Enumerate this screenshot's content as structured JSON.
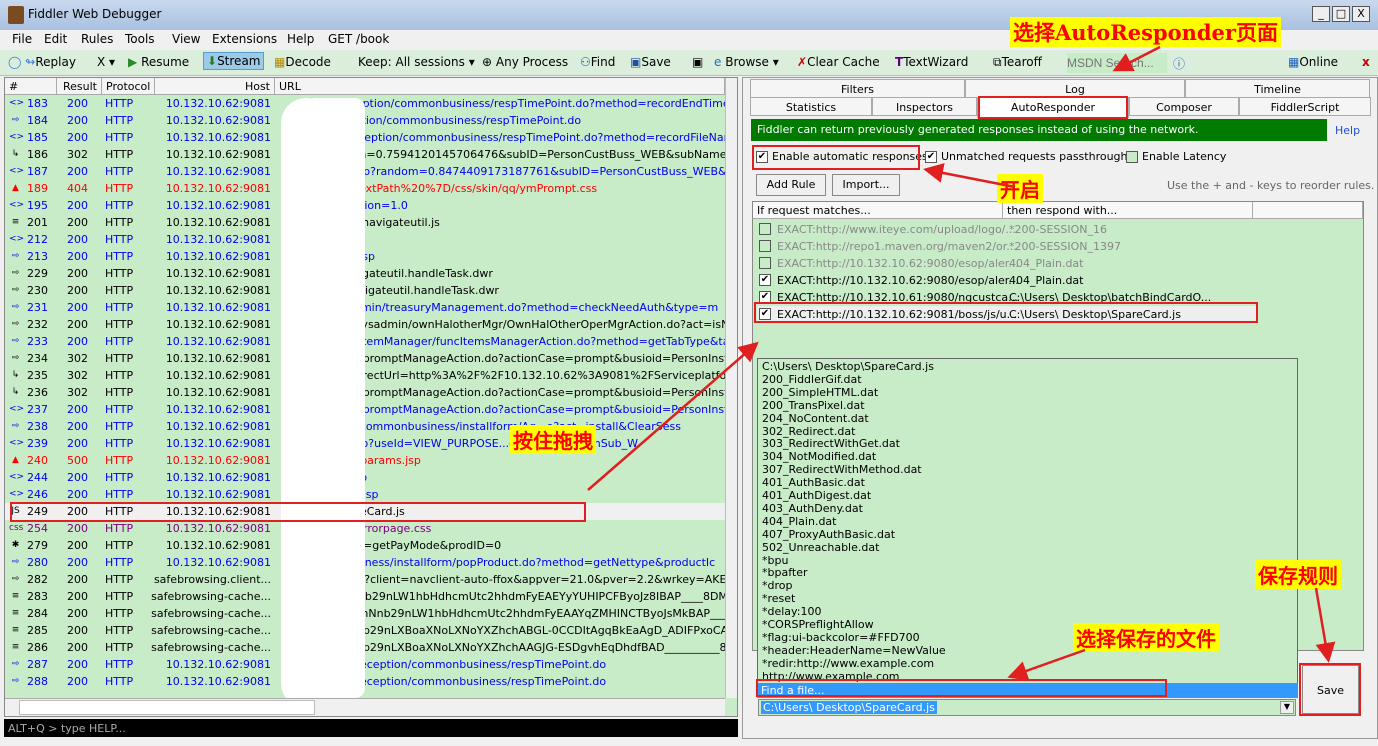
{
  "window": {
    "title": "Fiddler Web Debugger",
    "min": "_",
    "max": "□",
    "close": "X"
  },
  "menu": [
    "File",
    "Edit",
    "Rules",
    "Tools",
    "View",
    "Extensions",
    "Help",
    "GET /book"
  ],
  "toolbar": {
    "replay": "Replay",
    "remove": "X ▾",
    "resume": "Resume",
    "stream": "Stream",
    "decode": "Decode",
    "keep": "Keep: All sessions ▾",
    "process": "Any Process",
    "find": "Find",
    "save": "Save",
    "browse": "Browse ▾",
    "clear_cache": "Clear Cache",
    "textwizard": "TextWizard",
    "tearoff": "Tearoff",
    "msdn_placeholder": "MSDN Search...",
    "online": "Online"
  },
  "sessions": {
    "columns": [
      "#",
      "Result",
      "Protocol",
      "Host",
      "URL"
    ],
    "rows": [
      {
        "id": "183",
        "result": "200",
        "protocol": "HTTP",
        "host": "10.132.10.62:9081",
        "url": "/reception/commonbusiness/respTimePoint.do?method=recordEndTime",
        "color": "blue",
        "icon": "<>"
      },
      {
        "id": "184",
        "result": "200",
        "protocol": "HTTP",
        "host": "10.132.10.62:9081",
        "url": "eception/commonbusiness/respTimePoint.do",
        "color": "blue",
        "icon": "⇨"
      },
      {
        "id": "185",
        "result": "200",
        "protocol": "HTTP",
        "host": "10.132.10.62:9081",
        "url": "D/reception/commonbusiness/respTimePoint.do?method=recordFileNam",
        "color": "blue",
        "icon": "<>"
      },
      {
        "id": "186",
        "result": "302",
        "protocol": "HTTP",
        "host": "10.132.10.62:9081",
        "url": "ndom=0.7594120145706476&subID=PersonCustBuss_WEB&subName=%E",
        "color": "black",
        "icon": "↳"
      },
      {
        "id": "187",
        "result": "200",
        "protocol": "HTTP",
        "host": "10.132.10.62:9081",
        "url": "cal.jsp?random=0.8474409173187761&subID=PersonCustBuss_WEB&s",
        "color": "blue",
        "icon": "<>"
      },
      {
        "id": "189",
        "result": "404",
        "protocol": "HTTP",
        "host": "10.132.10.62:9081",
        "url": "contextPath%20%7D/css/skin/qq/ymPrompt.css",
        "color": "red",
        "icon": "▲"
      },
      {
        "id": "195",
        "result": "200",
        "protocol": "HTTP",
        "host": "10.132.10.62:9081",
        "url": "?version=1.0",
        "color": "blue",
        "icon": "<>"
      },
      {
        "id": "201",
        "result": "200",
        "protocol": "HTTP",
        "host": "10.132.10.62:9081",
        "url": "face/navigateutil.js",
        "color": "black",
        "icon": "≡"
      },
      {
        "id": "212",
        "result": "200",
        "protocol": "HTTP",
        "host": "10.132.10.62:9081",
        "url": "jsp",
        "color": "blue",
        "icon": "<>"
      },
      {
        "id": "213",
        "result": "200",
        "protocol": "HTTP",
        "host": "10.132.10.62:9081",
        "url": "mpl.jsp",
        "color": "blue",
        "icon": "⇨"
      },
      {
        "id": "229",
        "result": "200",
        "protocol": "HTTP",
        "host": "10.132.10.62:9081",
        "url": "/navigateutil.handleTask.dwr",
        "color": "black",
        "icon": "⇨"
      },
      {
        "id": "230",
        "result": "200",
        "protocol": "HTTP",
        "host": "10.132.10.62:9081",
        "url": "c/navigateutil.handleTask.dwr",
        "color": "black",
        "icon": "⇨"
      },
      {
        "id": "231",
        "result": "200",
        "protocol": "HTTP",
        "host": "10.132.10.62:9081",
        "url": "ysadmin/treasuryManagement.do?method=checkNeedAuth&type=m",
        "color": "blue",
        "icon": "⇨"
      },
      {
        "id": "232",
        "result": "200",
        "protocol": "HTTP",
        "host": "10.132.10.62:9081",
        "url": "GD/sysadmin/ownHalotherMgr/OwnHalOtherOperMgrAction.do?act=isNe",
        "color": "black",
        "icon": "⇨"
      },
      {
        "id": "233",
        "result": "200",
        "protocol": "HTTP",
        "host": "10.132.10.62:9081",
        "url": "funcItemManager/funcItemsManagerAction.do?method=getTabType&tabTy",
        "color": "blue",
        "icon": "⇨"
      },
      {
        "id": "234",
        "result": "302",
        "protocol": "HTTP",
        "host": "10.132.10.62:9081",
        "url": "Web/promptManageAction.do?actionCase=prompt&busioid=PersonInstallFo",
        "color": "black",
        "icon": "⇨"
      },
      {
        "id": "235",
        "result": "302",
        "protocol": "HTTP",
        "host": "10.132.10.62:9081",
        "url": "PredirectUrl=http%3A%2F%2F10.132.10.62%3A9081%2FServiceplatformW",
        "color": "black",
        "icon": "↳"
      },
      {
        "id": "236",
        "result": "302",
        "protocol": "HTTP",
        "host": "10.132.10.62:9081",
        "url": "Web/promptManageAction.do?actionCase=prompt&busioid=PersonInstallFo",
        "color": "black",
        "icon": "↳"
      },
      {
        "id": "237",
        "result": "200",
        "protocol": "HTTP",
        "host": "10.132.10.62:9081",
        "url": "Web/promptManageAction.do?actionCase=prompt&busioid=PersonInstallFo",
        "color": "blue",
        "icon": "<>"
      },
      {
        "id": "238",
        "result": "200",
        "protocol": "HTTP",
        "host": "10.132.10.62:9081",
        "url": "tion/commonbusiness/installform/Ag...o?act=install&ClearSess",
        "color": "blue",
        "icon": "⇨"
      },
      {
        "id": "239",
        "result": "200",
        "protocol": "HTTP",
        "host": "10.132.10.62:9081",
        "url": "32.jsp?useId=VIEW_PURPOSE...ersonInstallFormSub_W",
        "color": "blue",
        "icon": "<>"
      },
      {
        "id": "240",
        "result": "500",
        "protocol": "HTTP",
        "host": "10.132.10.62:9081",
        "url": "oss3params.jsp",
        "color": "red",
        "icon": "▲"
      },
      {
        "id": "244",
        "result": "200",
        "protocol": "HTTP",
        "host": "10.132.10.62:9081",
        "url": "all.jsp",
        "color": "blue",
        "icon": "<>"
      },
      {
        "id": "246",
        "result": "200",
        "protocol": "HTTP",
        "host": "10.132.10.62:9081",
        "url": "ndar.jsp",
        "color": "blue",
        "icon": "<>"
      },
      {
        "id": "249",
        "result": "200",
        "protocol": "HTTP",
        "host": "10.132.10.62:9081",
        "url": "SpareCard.js",
        "color": "black",
        "icon": "JS",
        "selected": true
      },
      {
        "id": "254",
        "result": "200",
        "protocol": "HTTP",
        "host": "10.132.10.62:9081",
        "url": "css/errorpage.css",
        "color": "purple",
        "icon": "css"
      },
      {
        "id": "279",
        "result": "200",
        "protocol": "HTTP",
        "host": "10.132.10.62:9081",
        "url": "funId=getPayMode&prodID=0",
        "color": "black",
        "icon": "✱"
      },
      {
        "id": "280",
        "result": "200",
        "protocol": "HTTP",
        "host": "10.132.10.62:9081",
        "url": "nbusiness/installform/popProduct.do?method=getNettype&productIc",
        "color": "blue",
        "icon": "⇨"
      },
      {
        "id": "282",
        "result": "200",
        "protocol": "HTTP",
        "host": "safebrowsing.client...",
        "url": "loads?client=navclient-auto-ffox&appver=21.0&pver=2.2&wrkey=AKEg",
        "color": "black",
        "icon": "⇨"
      },
      {
        "id": "283",
        "result": "200",
        "protocol": "HTTP",
        "host": "safebrowsing-cache...",
        "url": "ChNnb29nLW1hbHdhcmUtc2hhdmFyEAEYyYUHIPCFByoJz8IBAP____8DMg",
        "color": "black",
        "icon": "≡"
      },
      {
        "id": "284",
        "result": "200",
        "protocol": "HTTP",
        "host": "safebrowsing-cache...",
        "url": "/rd/ChNnb29nLW1hbHdhcmUtc2hhdmFyEAAYqZMHINCTByoJsMkBAP____8BM",
        "color": "black",
        "icon": "≡"
      },
      {
        "id": "285",
        "result": "200",
        "protocol": "HTTP",
        "host": "safebrowsing-cache...",
        "url": "ChFnb29nLXBoaXNoLXNoYXZhchABGL-0CCDItAgqBkEaAgD_ADIFPxoCAAM",
        "color": "black",
        "icon": "≡"
      },
      {
        "id": "286",
        "result": "200",
        "protocol": "HTTP",
        "host": "safebrowsing-cache...",
        "url": "ChFnb29nLXBoaXNoLXNoYXZhchAAGJG-ESDgvhEqDhdfBAD__________8",
        "color": "black",
        "icon": "≡"
      },
      {
        "id": "287",
        "result": "200",
        "protocol": "HTTP",
        "host": "10.132.10.62:9081",
        "url": "GD/reception/commonbusiness/respTimePoint.do",
        "color": "blue",
        "icon": "⇨"
      },
      {
        "id": "288",
        "result": "200",
        "protocol": "HTTP",
        "host": "10.132.10.62:9081",
        "url": "GD/reception/commonbusiness/respTimePoint.do",
        "color": "blue",
        "icon": "⇨"
      }
    ]
  },
  "quickexec": {
    "placeholder": "ALT+Q > type HELP..."
  },
  "tabs": {
    "row1": [
      "Filters",
      "Log",
      "Timeline"
    ],
    "row2": [
      "Statistics",
      "Inspectors",
      "AutoResponder",
      "Composer",
      "FiddlerScript"
    ],
    "active": "AutoResponder"
  },
  "autoresponder": {
    "banner": "Fiddler can return previously generated responses instead of using the network.",
    "help": "Help",
    "enable_auto": {
      "label": "Enable automatic responses",
      "checked": true
    },
    "passthrough": {
      "label": "Unmatched requests passthrough",
      "checked": true
    },
    "latency": {
      "label": "Enable Latency",
      "checked": false
    },
    "add_rule": "Add Rule",
    "import": "Import...",
    "hint": "Use the + and - keys to reorder rules.",
    "columns": [
      "If request matches...",
      "then respond with..."
    ],
    "rules": [
      {
        "match": "EXACT:http://www.iteye.com/upload/logo/...",
        "respond": "*200-SESSION_16",
        "checked": false
      },
      {
        "match": "EXACT:http://repo1.maven.org/maven2/or...",
        "respond": "*200-SESSION_1397",
        "checked": false
      },
      {
        "match": "EXACT:http://10.132.10.62:9080/esop/aler...",
        "respond": "404_Plain.dat",
        "checked": false
      },
      {
        "match": "EXACT:http://10.132.10.62:9080/esop/aler...",
        "respond": "404_Plain.dat",
        "checked": true
      },
      {
        "match": "EXACT:http://10.132.10.61:9080/ngcustca...",
        "respond": "C:\\Users\\          Desktop\\batchBindCardO...",
        "checked": true
      },
      {
        "match": "EXACT:http://10.132.10.62:9081/boss/js/u...",
        "respond": "C:\\Users\\          Desktop\\SpareCard.js",
        "checked": true,
        "selected": true
      }
    ],
    "dropdown": [
      "C:\\Users\\          Desktop\\SpareCard.js",
      "200_FiddlerGif.dat",
      "200_SimpleHTML.dat",
      "200_TransPixel.dat",
      "204_NoContent.dat",
      "302_Redirect.dat",
      "303_RedirectWithGet.dat",
      "304_NotModified.dat",
      "307_RedirectWithMethod.dat",
      "401_AuthBasic.dat",
      "401_AuthDigest.dat",
      "403_AuthDeny.dat",
      "404_Plain.dat",
      "407_ProxyAuthBasic.dat",
      "502_Unreachable.dat",
      "*bpu",
      "*bpafter",
      "*drop",
      "*reset",
      "*delay:100",
      "*CORSPreflightAllow",
      "*flag:ui-backcolor=#FFD700",
      "*header:HeaderName=NewValue",
      "*redir:http://www.example.com",
      "http://www.example.com"
    ],
    "find_file": "Find a file...",
    "combo_value": "C:\\Users\\          Desktop\\SpareCard.js",
    "save": "Save"
  },
  "annotations": {
    "autoresponder": "选择AutoResponder页面",
    "enable": "开启",
    "drag": "按住拖拽",
    "choose_file": "选择保存的文件",
    "save_rule": "保存规则"
  },
  "colors": {
    "session_bg": "#c8ebc8",
    "banner": "#007a00",
    "highlight": "#3399ff",
    "annotation_bg": "#ffff00",
    "annotation_text": "#ff0000"
  }
}
